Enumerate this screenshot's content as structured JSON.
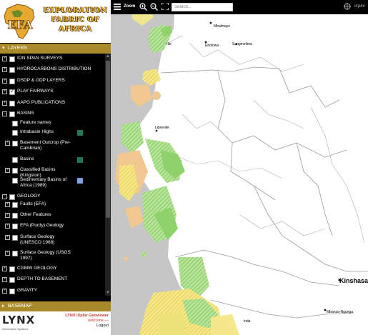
{
  "app": {
    "logo_text": "EFA",
    "title": "EXPLORATION FABRIC OF AFRICA"
  },
  "panels": {
    "layers_label": "LAYERS",
    "basemap_label": "BASEMAP"
  },
  "layers": [
    {
      "label": "ION SPAN SURVEYS",
      "expand": "+",
      "checked": false,
      "swatch": null
    },
    {
      "label": "HYDROCARBONS DISTRIBUTION",
      "expand": "+",
      "checked": false,
      "swatch": null
    },
    {
      "label": "DSDP & ODP LAYERS",
      "expand": "+",
      "checked": false,
      "swatch": null
    },
    {
      "label": "PLAY FAIRWAYS",
      "expand": "+",
      "checked": true,
      "swatch": null
    },
    {
      "label": "AAPG PUBLICATIONS",
      "expand": "+",
      "checked": false,
      "swatch": null
    },
    {
      "label": "BASINS",
      "expand": "-",
      "checked": false,
      "swatch": null
    },
    {
      "label": "Feature names",
      "expand": "",
      "checked": false,
      "swatch": null
    },
    {
      "label": "Intrabasin Highs",
      "expand": "",
      "checked": false,
      "swatch": "#1e7a55"
    },
    {
      "label": "Basement Outcrop (Pre-Cambrian)",
      "expand": "+",
      "checked": false,
      "swatch": null
    },
    {
      "label": "Basins",
      "expand": "",
      "checked": false,
      "swatch": "#1e7a55"
    },
    {
      "label": "Classified Basins (Kingston)",
      "expand": "+",
      "checked": false,
      "swatch": null
    },
    {
      "label": "Sedimentary Basins of Africa (1989)",
      "expand": "",
      "checked": false,
      "swatch": "#7fa0e0"
    },
    {
      "label": "GEOLOGY",
      "expand": "-",
      "checked": false,
      "swatch": null
    },
    {
      "label": "Faults (EFA)",
      "expand": "+",
      "checked": false,
      "swatch": null
    },
    {
      "label": "Other Features",
      "expand": "+",
      "checked": false,
      "swatch": null
    },
    {
      "label": "EFA (Purdy) Geology",
      "expand": "+",
      "checked": false,
      "swatch": null
    },
    {
      "label": "Surface Geology (UNESCO 1968)",
      "expand": "+",
      "checked": false,
      "swatch": null
    },
    {
      "label": "Surface Geology (USGS 1997)",
      "expand": "+",
      "checked": false,
      "swatch": null
    },
    {
      "label": "CGMW GEOLOGY",
      "expand": "+",
      "checked": false,
      "swatch": null
    },
    {
      "label": "DEPTH TO BASEMENT",
      "expand": "+",
      "checked": false,
      "swatch": null
    },
    {
      "label": "GRAVITY",
      "expand": "+",
      "checked": false,
      "swatch": null
    }
  ],
  "toolbar": {
    "zoom_label": "Zoom",
    "search_placeholder": "Search...",
    "ixplor_label": "iXplor"
  },
  "footer": {
    "logo_text": "LYNX",
    "logo_tagline": "Information Systems",
    "product": "LYNX iXplor Geoviewer",
    "welcome": "welcome —",
    "logout": "Logout"
  },
  "map": {
    "cities": {
      "mbalmayo": "Mbalmayo",
      "ebolowa": "Ebolowa",
      "sangmelima": "Sangmelima",
      "ribi": "ribi",
      "libreville": "Libreville",
      "kinshasa": "Kinshasa",
      "mbanza": "Mbanza-Ngungu",
      "inda": "inda"
    },
    "colors": {
      "ocean": "#c8c8c8",
      "land": "#ffffff",
      "green": "#8fd16a",
      "yellow": "#f4e26b",
      "orange": "#f0c890",
      "border": "#9a9a9a"
    }
  }
}
